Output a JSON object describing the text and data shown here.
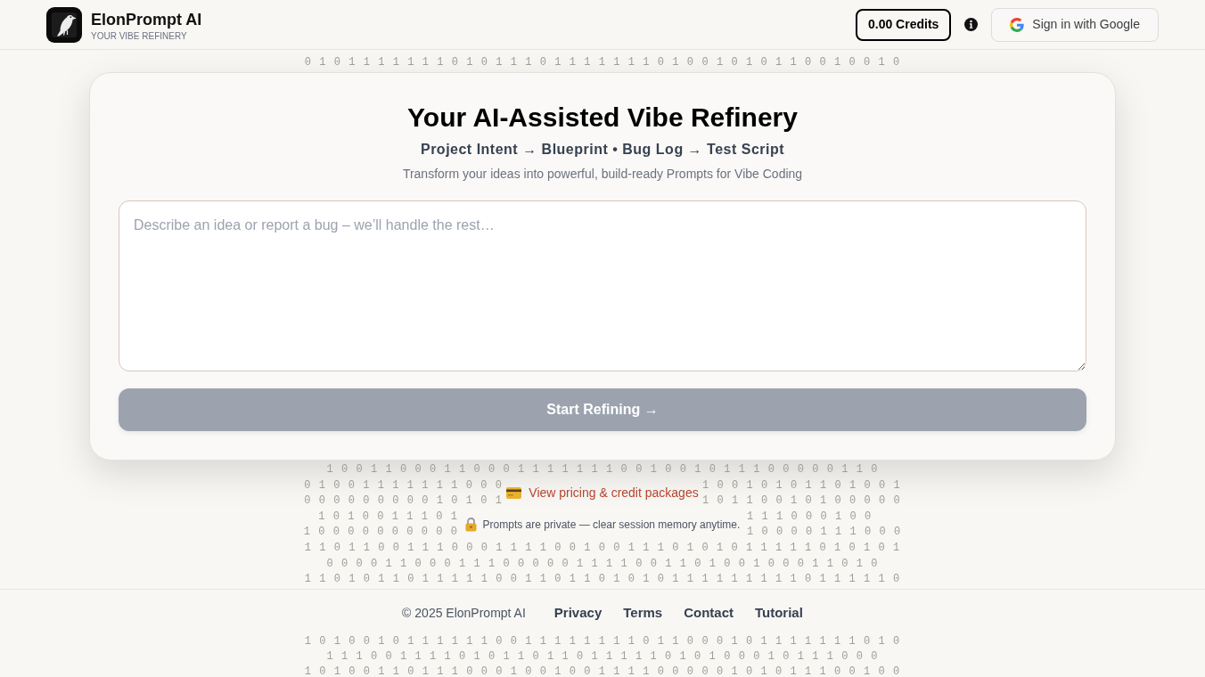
{
  "header": {
    "brand_name": "ElonPrompt AI",
    "tagline": "YOUR VIBE REFINERY",
    "credits": "0.00 Credits",
    "sign_in": "Sign in with Google"
  },
  "pattern_top": [
    "0 1 0 1 1 1 1 1 1 1 0 1 0 1 1 1 0 1 1 1 1 1 1 1 0 1 0 0 1 0 1 0 1 1 0 0 1 0 0 1 0"
  ],
  "hero": {
    "title": "Your AI-Assisted Vibe Refinery",
    "flow": "Project Intent → Blueprint • Bug Log → Test Script",
    "description": "Transform your ideas into powerful, build-ready Prompts for Vibe Coding"
  },
  "prompt_field": {
    "placeholder": "Describe an idea or report a bug – we’ll handle the rest…"
  },
  "start_button": {
    "label": "Start Refining →",
    "disabled": true
  },
  "lower": {
    "rows_before": [
      "1 0 0 1 1 0 0 0 1 1 0 0 0 1 1 1 1 1 1 1 0 0 1 0 0 1 0 1 1 1 0 0 0 0 0 1 1 0"
    ],
    "pricing_link": {
      "label": "View pricing & credit packages",
      "rows_left": [
        "0 1 0 0 1 1 1 1 1 1 1 0 0 0",
        "0 0 0 0 0 0 0 0 0 1 0 1 0 1"
      ],
      "rows_right": [
        "1 0 0 1 0 1 0 1 1 0 1 0 0 1",
        "1 0 1 1 0 0 1 0 1 0 0 0 0 0"
      ]
    },
    "privacy_note": {
      "text": "Prompts are private — clear session memory anytime.",
      "rows_left": [
        "1 0 1 0 0 1 1 1 0 1",
        "1 0 0 0 0 0 0 0 0 0 0"
      ],
      "rows_right": [
        "1 1 1 0 0 0 1 0 0",
        "1 0 0 0 0 1 1 1 0 0 0"
      ]
    },
    "rows_after": [
      "1 1 0 1 1 0 0 1 1 1 0 0 0 1 1 1 1 0 0 1 0 0 1 1 1 0 1 0 1 0 1 1 1 1 1 0 1 0 1 0 1",
      "0 0 0 0 1 1 0 0 0 1 1 1 0 0 0 0 0 1 1 1 1 0 0 1 1 0 1 0 0 1 0 0 0 1 1 0 1 0",
      "1 1 0 1 0 1 1 0 1 1 1 1 1 0 0 1 1 0 1 1 0 1 0 1 0 1 1 1 1 1 1 1 1 1 0 1 1 1 1 1 0"
    ]
  },
  "footer": {
    "copyright": "© 2025 ElonPrompt AI",
    "links": [
      "Privacy",
      "Terms",
      "Contact",
      "Tutorial"
    ],
    "pattern_rows": [
      "1 0 1 0 0 1 0 1 1 1 1 1 1 0 0 1 1 1 1 1 1 1 1 0 1 1 0 0 0 1 0 1 1 1 1 1 1 1 0 1 0",
      "1 1 1 0 0 1 1 1 1 0 1 0 1 1 0 1 1 0 1 1 1 1 1 0 1 0 1 0 0 0 1 0 1 1 1 0 0 0",
      "1 0 1 0 0 1 1 0 1 1 1 0 0 0 1 0 0 1 0 0 1 1 1 1 0 0 0 0 0 1 0 1 0 1 1 1 0 0 1 0 0"
    ]
  }
}
